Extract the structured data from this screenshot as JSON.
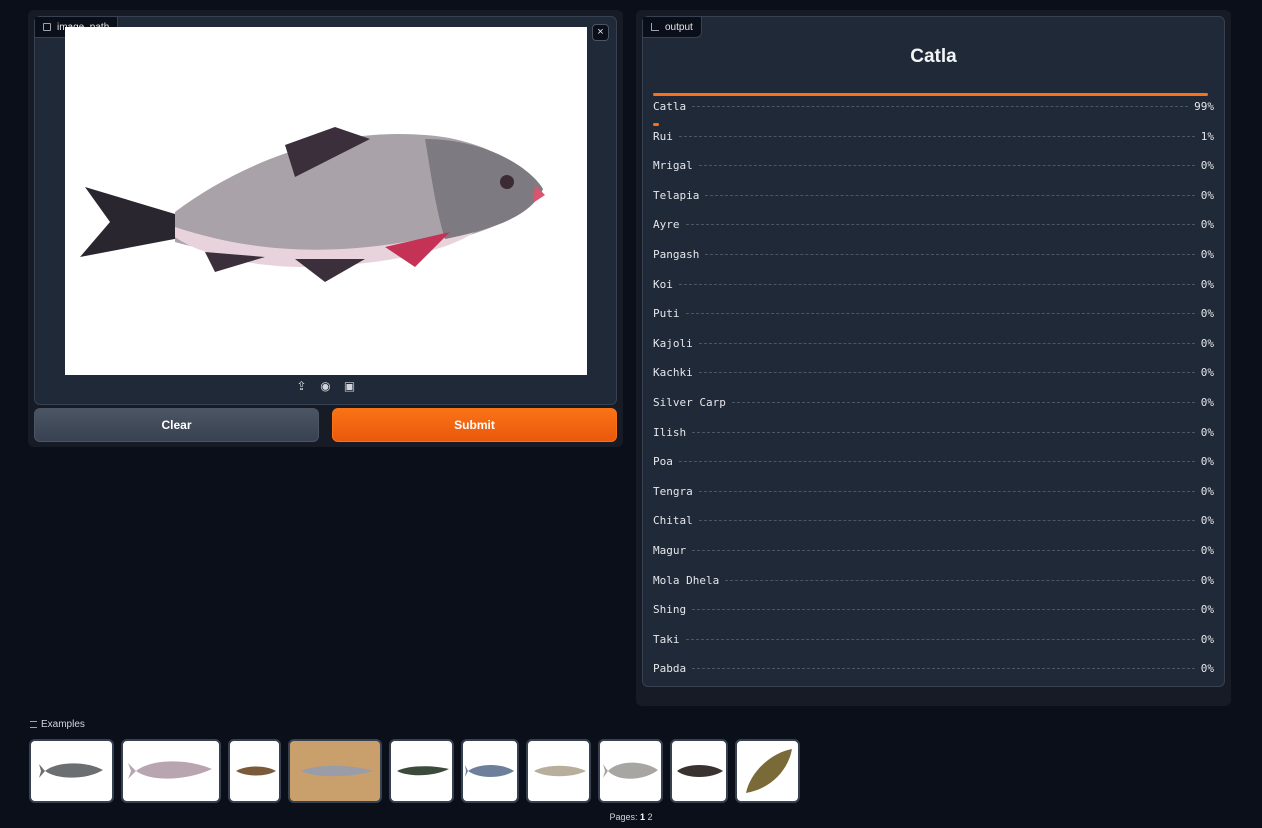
{
  "input": {
    "label": "image_path",
    "close_symbol": "×",
    "source_icons": [
      "upload-icon",
      "webcam-icon",
      "clipboard-icon"
    ]
  },
  "buttons": {
    "clear": "Clear",
    "submit": "Submit"
  },
  "output": {
    "label": "output",
    "top_label": "Catla",
    "confidences": [
      {
        "label": "Catla",
        "value": "99%",
        "fraction": 0.99
      },
      {
        "label": "Rui",
        "value": "1%",
        "fraction": 0.01
      },
      {
        "label": "Mrigal",
        "value": "0%",
        "fraction": 0
      },
      {
        "label": "Telapia",
        "value": "0%",
        "fraction": 0
      },
      {
        "label": "Ayre",
        "value": "0%",
        "fraction": 0
      },
      {
        "label": "Pangash",
        "value": "0%",
        "fraction": 0
      },
      {
        "label": "Koi",
        "value": "0%",
        "fraction": 0
      },
      {
        "label": "Puti",
        "value": "0%",
        "fraction": 0
      },
      {
        "label": "Kajoli",
        "value": "0%",
        "fraction": 0
      },
      {
        "label": "Kachki",
        "value": "0%",
        "fraction": 0
      },
      {
        "label": "Silver Carp",
        "value": "0%",
        "fraction": 0
      },
      {
        "label": "Ilish",
        "value": "0%",
        "fraction": 0
      },
      {
        "label": "Poa",
        "value": "0%",
        "fraction": 0
      },
      {
        "label": "Tengra",
        "value": "0%",
        "fraction": 0
      },
      {
        "label": "Chital",
        "value": "0%",
        "fraction": 0
      },
      {
        "label": "Magur",
        "value": "0%",
        "fraction": 0
      },
      {
        "label": "Mola Dhela",
        "value": "0%",
        "fraction": 0
      },
      {
        "label": "Shing",
        "value": "0%",
        "fraction": 0
      },
      {
        "label": "Taki",
        "value": "0%",
        "fraction": 0
      },
      {
        "label": "Pabda",
        "value": "0%",
        "fraction": 0
      }
    ]
  },
  "examples": {
    "label": "Examples",
    "pages_label": "Pages:",
    "current_page": "1",
    "other_page": "2"
  },
  "colors": {
    "accent": "#f97316",
    "background": "#0b0f19",
    "panel": "#1f2937"
  }
}
